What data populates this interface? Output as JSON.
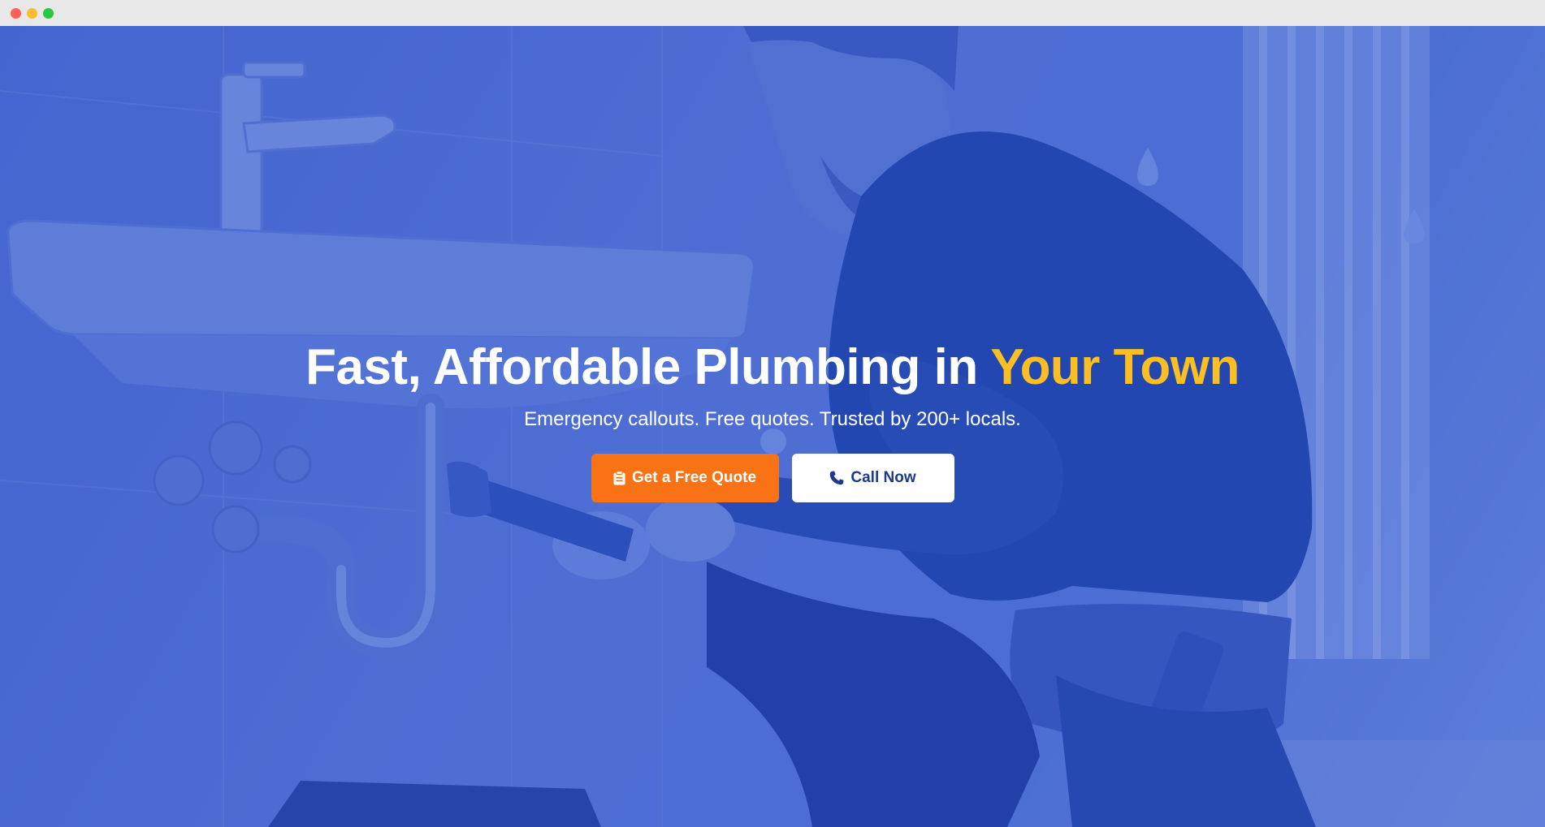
{
  "window": {
    "controls": [
      "close",
      "minimize",
      "maximize"
    ]
  },
  "hero": {
    "headline_main": "Fast, Affordable Plumbing in ",
    "headline_accent": "Your Town",
    "subheadline": "Emergency callouts. Free quotes. Trusted by 200+ locals.",
    "background_image": "plumber-under-sink-photo",
    "primary_cta": {
      "label": "Get a Free Quote",
      "icon": "clipboard-icon"
    },
    "secondary_cta": {
      "label": "Call Now",
      "icon": "phone-icon"
    }
  },
  "colors": {
    "overlay_blue": "#4d6bd2",
    "accent_yellow": "#fbbf24",
    "cta_orange": "#f97316",
    "call_text_navy": "#1e3a8a",
    "white": "#ffffff"
  }
}
